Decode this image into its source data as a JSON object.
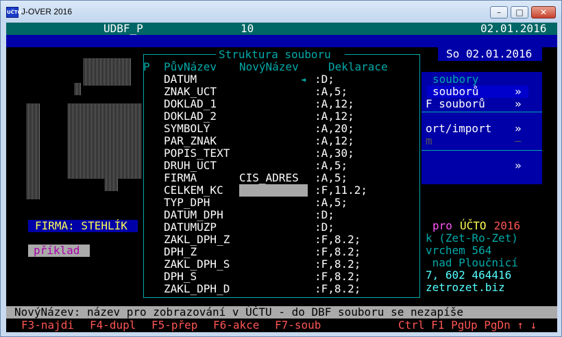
{
  "window": {
    "title": "J-OVER 2016",
    "icon": "UČTO",
    "buttons": [
      "–",
      "□",
      "✕"
    ]
  },
  "topbar": {
    "file": "UDBF_P",
    "number": "10",
    "date": "02.01.2016"
  },
  "datebox": "So 02.01.2016",
  "dialog": {
    "title": "Struktura souboru",
    "headers": {
      "p": "P",
      "orig": "PůvNázev",
      "new": "NovýNázev",
      "decl": "Deklarace"
    },
    "rows": [
      {
        "orig": "DATUM",
        "new": "",
        "decl": ":D;"
      },
      {
        "orig": "ZNAK_UCT",
        "new": "",
        "decl": ":A,5;"
      },
      {
        "orig": "DOKLAD_1",
        "new": "",
        "decl": ":A,12;"
      },
      {
        "orig": "DOKLAD_2",
        "new": "",
        "decl": ":A,12;"
      },
      {
        "orig": "SYMBOLY",
        "new": "",
        "decl": ":A,20;"
      },
      {
        "orig": "PAR_ZNAK",
        "new": "",
        "decl": ":A,12;"
      },
      {
        "orig": "POPIS_TEXT",
        "new": "",
        "decl": ":A,30;"
      },
      {
        "orig": "DRUH_UCT",
        "new": "",
        "decl": ":A,5;"
      },
      {
        "orig": "FIRMA",
        "new": "CIS_ADRES",
        "decl": ":A,5;"
      },
      {
        "orig": "CELKEM_KC",
        "new": "",
        "decl": ":F,11.2;"
      },
      {
        "orig": "TYP_DPH",
        "new": "",
        "decl": ":A,5;"
      },
      {
        "orig": "DATUM_DPH",
        "new": "",
        "decl": ":D;"
      },
      {
        "orig": "DATUMUZP",
        "new": "",
        "decl": ":D;"
      },
      {
        "orig": "ZAKL_DPH_Z",
        "new": "",
        "decl": ":F,8.2;"
      },
      {
        "orig": "DPH_Z",
        "new": "",
        "decl": ":F,8.2;"
      },
      {
        "orig": "ZAKL_DPH_S",
        "new": "",
        "decl": ":F,8.2;"
      },
      {
        "orig": "DPH_S",
        "new": "",
        "decl": ":F,8.2;"
      },
      {
        "orig": "ZAKL_DPH_D",
        "new": "",
        "decl": ":F,8.2;"
      }
    ],
    "arrow": "◄"
  },
  "menu": {
    "title": "soubory",
    "items": [
      {
        "label": "souborů",
        "arrow": "»"
      },
      {
        "label": "F souborů",
        "arrow": "»"
      },
      {
        "label": "ort/import",
        "arrow": "»"
      },
      {
        "label": "m",
        "arrow": "–"
      },
      {
        "label": "",
        "arrow": "»"
      }
    ]
  },
  "firma": "FIRMA: STEHLÍK",
  "priklad": "příklad",
  "info": {
    "line1a": "pro ",
    "line1b": "ÚČTO",
    "line1c": " 2016",
    "line2": "k (Zet-Ro-Zet)",
    "line3": "vrchem 564",
    "line4": " nad Ploučnicí",
    "line5": "7, 602 464416",
    "line6": "zetrozet.biz"
  },
  "status": "NovýNázev: název pro zobrazování v ÚČTU - do DBF souboru se nezapíše",
  "fkeys": {
    "f3": "F3-najdi",
    "f4": "F4-dupl",
    "f5": "F5-přep",
    "f6": "F6-akce",
    "f7": "F7-soub",
    "right": "Ctrl F1 PgUp PgDn ↑ ↓"
  }
}
